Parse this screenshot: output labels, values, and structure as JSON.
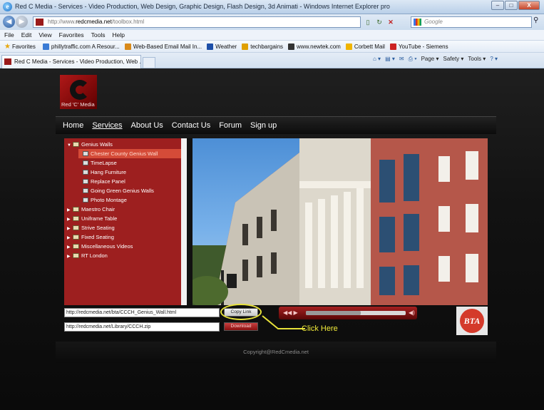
{
  "window": {
    "title": "Red C Media - Services - Video Production, Web Design, Graphic Design, Flash Design, 3d Animati - Windows Internet Explorer pro",
    "buttons": {
      "minimize": "–",
      "maximize": "□",
      "close": "X"
    }
  },
  "address": {
    "url_prefix": "http://www.",
    "url_host": "redcmedia.net",
    "url_path": "/toolbox.html",
    "search_placeholder": "Google"
  },
  "menu": [
    "File",
    "Edit",
    "View",
    "Favorites",
    "Tools",
    "Help"
  ],
  "favorites": {
    "label": "Favorites",
    "items": [
      {
        "label": "phillytraffic.com A Resour...",
        "color": "#3a7bd5"
      },
      {
        "label": "Web-Based Email Mail In...",
        "color": "#d98a1a"
      },
      {
        "label": "Weather",
        "color": "#1d4fa8"
      },
      {
        "label": "techbargains",
        "color": "#e0a000"
      },
      {
        "label": "www.newtek.com",
        "color": "#333333"
      },
      {
        "label": "Corbett Mail",
        "color": "#f0b400"
      },
      {
        "label": "YouTube - Siemens",
        "color": "#cc2222"
      }
    ]
  },
  "tab": {
    "label": "Red C Media - Services - Video Production, Web ...",
    "commands": [
      "Page ▾",
      "Safety ▾",
      "Tools ▾"
    ]
  },
  "site": {
    "logo_text": "Red 'C' Media",
    "nav": [
      "Home",
      "Services",
      "About Us",
      "Contact Us",
      "Forum",
      "Sign up"
    ],
    "tree": [
      {
        "label": "Genius Walls",
        "level": 0,
        "arrow": "▼",
        "type": "folder"
      },
      {
        "label": "Chester County Genius Wall",
        "level": 1,
        "type": "film",
        "selected": true
      },
      {
        "label": "TimeLapse",
        "level": 1,
        "type": "film"
      },
      {
        "label": "Hang Furniture",
        "level": 1,
        "type": "film"
      },
      {
        "label": "Replace Panel",
        "level": 1,
        "type": "film"
      },
      {
        "label": "Going Green Genius Walls",
        "level": 1,
        "type": "film"
      },
      {
        "label": "Photo Montage",
        "level": 1,
        "type": "film"
      },
      {
        "label": "Maestro Chair",
        "level": 0,
        "arrow": "▶",
        "type": "folder"
      },
      {
        "label": "Uniframe Table",
        "level": 0,
        "arrow": "▶",
        "type": "folder"
      },
      {
        "label": "Strive Seating",
        "level": 0,
        "arrow": "▶",
        "type": "folder"
      },
      {
        "label": "Fixed Seating",
        "level": 0,
        "arrow": "▶",
        "type": "folder"
      },
      {
        "label": "Miscellaneous Videos",
        "level": 0,
        "arrow": "▶",
        "type": "folder"
      },
      {
        "label": "RT London",
        "level": 0,
        "arrow": "▶",
        "type": "folder"
      }
    ],
    "link_field_1": "http://redcmedia.net/bta/CCCH_Genius_Wall.html",
    "link_field_2": "http://redcmedia.net/Library/CCCH.zip",
    "copy_link_label": "Copy Link",
    "download_label": "Download",
    "click_here": "Click Here",
    "player_progress": 0.55,
    "bta_logo_text": "BTA",
    "footer": "Copyright@RedCmedia.net"
  }
}
